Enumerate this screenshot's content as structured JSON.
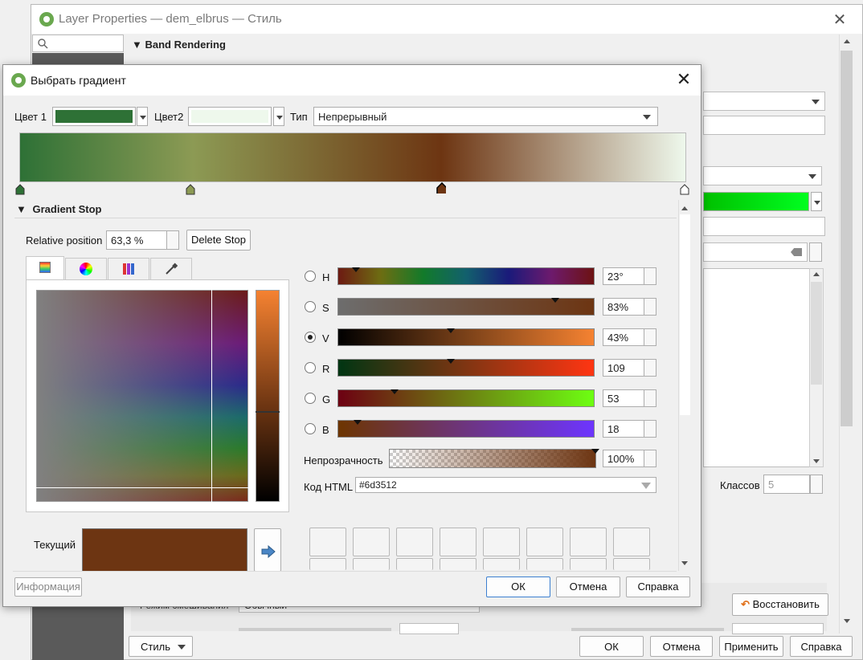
{
  "background_window": {
    "title": "Layer Properties — dem_elbrus — Стиль",
    "section_title": "Band Rendering",
    "classes_label": "Классов",
    "classes_value": "5",
    "restore_button": "Восстановить",
    "style_button": "Стиль",
    "ok_button": "ОК",
    "cancel_button": "Отмена",
    "apply_button": "Применить",
    "help_button": "Справка",
    "blend_label": "Режим смешивания",
    "blend_value": "Обычный"
  },
  "dialog": {
    "title": "Выбрать градиент",
    "color1_label": "Цвет 1",
    "color2_label": "Цвет2",
    "type_label": "Тип",
    "type_value": "Непрерывный",
    "gradient_stop_title": "Gradient Stop",
    "relative_position_label": "Relative position",
    "relative_position_value": "63,3 %",
    "delete_stop_button": "Delete Stop",
    "channels": [
      {
        "label": "H",
        "value": "23°"
      },
      {
        "label": "S",
        "value": "83%"
      },
      {
        "label": "V",
        "value": "43%"
      },
      {
        "label": "R",
        "value": "109"
      },
      {
        "label": "G",
        "value": "53"
      },
      {
        "label": "B",
        "value": "18"
      }
    ],
    "opacity_label": "Непрозрачность",
    "opacity_value": "100%",
    "html_code_label": "Код HTML",
    "html_code_value": "#6d3512",
    "current_label": "Текущий",
    "info_button": "Информация",
    "ok_button": "ОК",
    "cancel_button": "Отмена",
    "help_button": "Справка"
  },
  "colors": {
    "color1": "#2e7136",
    "color2": "#eef8ec",
    "current": "#6d3512",
    "gradient_stops": [
      "#2e7136",
      "#8c9a54",
      "#6d3512",
      "#eef8ec"
    ]
  },
  "icons": [
    "qgis-logo-icon",
    "close-icon",
    "search-icon",
    "dropdown-arrow-icon",
    "collapse-triangle-icon",
    "color-ramp-tab-icon",
    "color-wheel-tab-icon",
    "palette-tab-icon",
    "eyedropper-icon",
    "arrow-right-icon",
    "restore-icon",
    "clear-icon"
  ]
}
